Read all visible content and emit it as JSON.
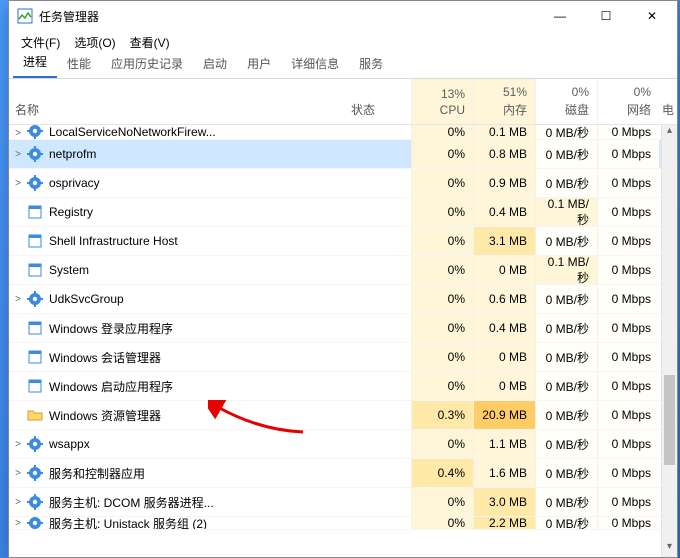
{
  "window": {
    "title": "任务管理器",
    "buttons": {
      "min": "—",
      "max": "☐",
      "close": "✕"
    }
  },
  "menu": {
    "file": "文件(F)",
    "options": "选项(O)",
    "view": "查看(V)"
  },
  "tabs": [
    "进程",
    "性能",
    "应用历史记录",
    "启动",
    "用户",
    "详细信息",
    "服务"
  ],
  "columns": {
    "name": "名称",
    "status": "状态",
    "cpu": {
      "pct": "13%",
      "label": "CPU"
    },
    "mem": {
      "pct": "51%",
      "label": "内存"
    },
    "disk": {
      "pct": "0%",
      "label": "磁盘"
    },
    "net": {
      "pct": "0%",
      "label": "网络"
    },
    "power": {
      "label": "电"
    }
  },
  "rows": [
    {
      "icon": "gear",
      "exp": ">",
      "name": "LocalServiceNoNetworkFirew...",
      "cpu": "0%",
      "mem": "0.1 MB",
      "disk": "0 MB/秒",
      "net": "0 Mbps",
      "cut": true
    },
    {
      "icon": "gear",
      "exp": ">",
      "name": "netprofm",
      "cpu": "0%",
      "mem": "0.8 MB",
      "disk": "0 MB/秒",
      "net": "0 Mbps",
      "selected": true
    },
    {
      "icon": "gear",
      "exp": ">",
      "name": "osprivacy",
      "cpu": "0%",
      "mem": "0.9 MB",
      "disk": "0 MB/秒",
      "net": "0 Mbps"
    },
    {
      "icon": "box",
      "exp": "",
      "name": "Registry",
      "cpu": "0%",
      "mem": "0.4 MB",
      "disk": "0.1 MB/秒",
      "net": "0 Mbps",
      "diskhl": true
    },
    {
      "icon": "box",
      "exp": "",
      "name": "Shell Infrastructure Host",
      "cpu": "0%",
      "mem": "3.1 MB",
      "disk": "0 MB/秒",
      "net": "0 Mbps",
      "memhl": true
    },
    {
      "icon": "box",
      "exp": "",
      "name": "System",
      "cpu": "0%",
      "mem": "0 MB",
      "disk": "0.1 MB/秒",
      "net": "0 Mbps",
      "diskhl": true
    },
    {
      "icon": "gear",
      "exp": ">",
      "name": "UdkSvcGroup",
      "cpu": "0%",
      "mem": "0.6 MB",
      "disk": "0 MB/秒",
      "net": "0 Mbps"
    },
    {
      "icon": "box",
      "exp": "",
      "name": "Windows 登录应用程序",
      "cpu": "0%",
      "mem": "0.4 MB",
      "disk": "0 MB/秒",
      "net": "0 Mbps"
    },
    {
      "icon": "box",
      "exp": "",
      "name": "Windows 会话管理器",
      "cpu": "0%",
      "mem": "0 MB",
      "disk": "0 MB/秒",
      "net": "0 Mbps"
    },
    {
      "icon": "box",
      "exp": "",
      "name": "Windows 启动应用程序",
      "cpu": "0%",
      "mem": "0 MB",
      "disk": "0 MB/秒",
      "net": "0 Mbps"
    },
    {
      "icon": "folder",
      "exp": "",
      "name": "Windows 资源管理器",
      "cpu": "0.3%",
      "mem": "20.9 MB",
      "disk": "0 MB/秒",
      "net": "0 Mbps",
      "cpuhl": true,
      "memhot": true,
      "arrow": true
    },
    {
      "icon": "gear",
      "exp": ">",
      "name": "wsappx",
      "cpu": "0%",
      "mem": "1.1 MB",
      "disk": "0 MB/秒",
      "net": "0 Mbps"
    },
    {
      "icon": "gear",
      "exp": ">",
      "name": "服务和控制器应用",
      "cpu": "0.4%",
      "mem": "1.6 MB",
      "disk": "0 MB/秒",
      "net": "0 Mbps",
      "cpuhl": true
    },
    {
      "icon": "gear",
      "exp": ">",
      "name": "服务主机: DCOM 服务器进程...",
      "cpu": "0%",
      "mem": "3.0 MB",
      "disk": "0 MB/秒",
      "net": "0 Mbps",
      "memhl": true
    },
    {
      "icon": "gear",
      "exp": ">",
      "name": "服务主机: Unistack 服务组 (2)",
      "cpu": "0%",
      "mem": "2.2 MB",
      "disk": "0 MB/秒",
      "net": "0 Mbps",
      "cut": true,
      "memhl": true
    }
  ]
}
